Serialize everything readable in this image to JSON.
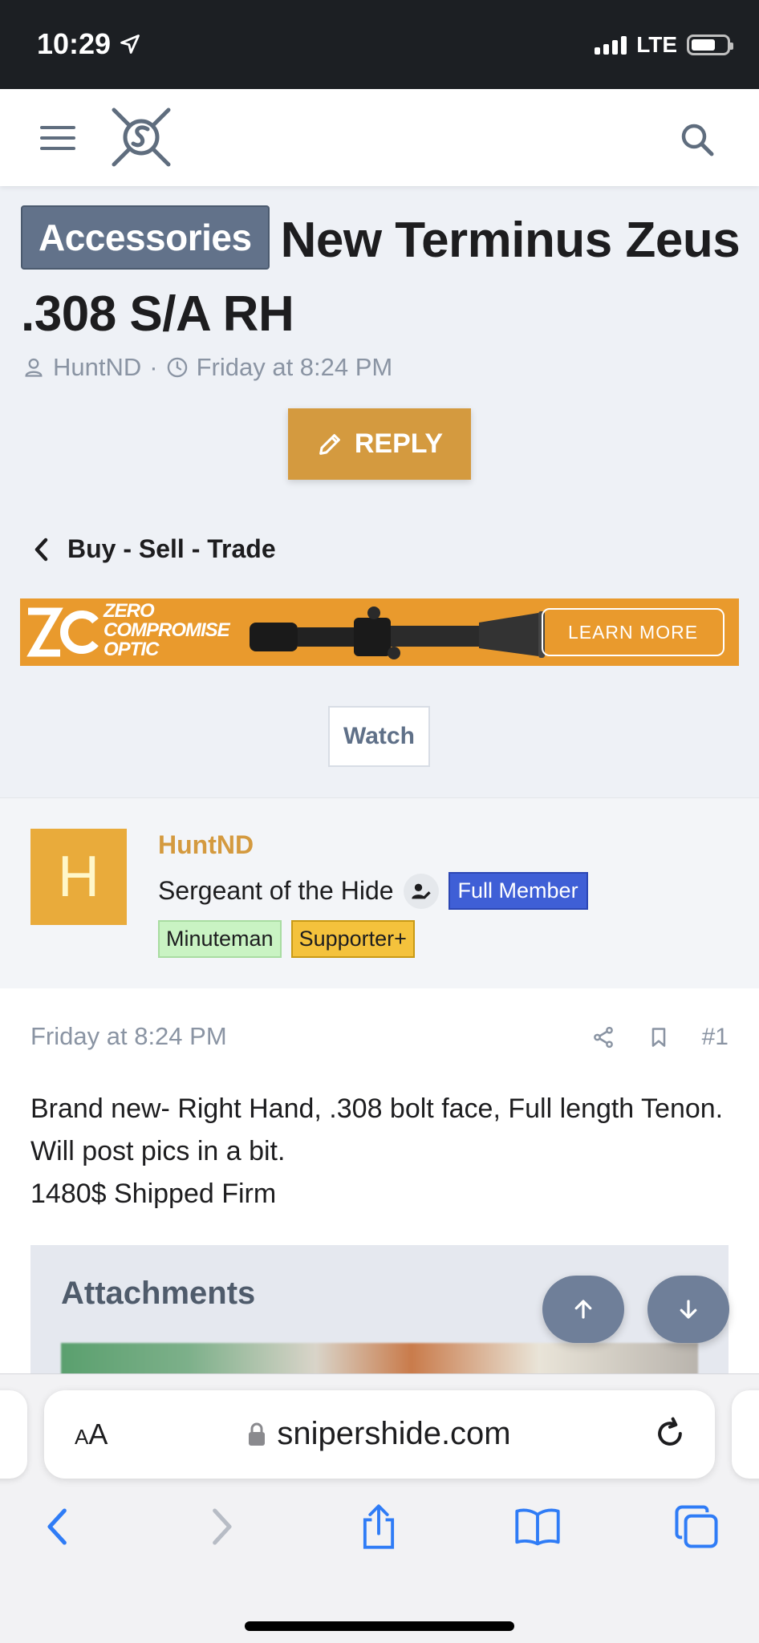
{
  "status_bar": {
    "time": "10:29",
    "network": "LTE"
  },
  "header": {
    "menu_icon": "hamburger-menu-icon",
    "logo_icon": "snipershide-logo-icon",
    "search_icon": "search-icon"
  },
  "thread": {
    "prefix": "Accessories",
    "title": "New Terminus Zeus .308 S/A RH",
    "author": "HuntND",
    "separator": "·",
    "date": "Friday at 8:24 PM"
  },
  "reply_button": {
    "label": "REPLY"
  },
  "breadcrumb": {
    "label": "Buy - Sell - Trade"
  },
  "banner": {
    "brand_line1": "ZERO",
    "brand_line2": "COMPROMISE",
    "brand_line3": "OPTIC",
    "cta": "LEARN MORE",
    "logo_text": "ZC"
  },
  "watch_button": {
    "label": "Watch"
  },
  "post": {
    "avatar_letter": "H",
    "username": "HuntND",
    "user_title": "Sergeant of the Hide",
    "badges": [
      "Full Member",
      "Minuteman",
      "Supporter+"
    ],
    "date": "Friday at 8:24 PM",
    "post_number": "#1",
    "body_lines": [
      "Brand new- Right Hand, .308 bolt face, Full length Tenon. Will post pics in a bit.",
      "1480$ Shipped Firm"
    ],
    "attachments_title": "Attachments"
  },
  "safari": {
    "text_size_label_big": "A",
    "text_size_label_small": "A",
    "url": "snipershide.com"
  },
  "colors": {
    "accent": "#d49a3f",
    "prefix_bg": "#62728a",
    "badge_full": "#3f5fd6",
    "badge_minuteman": "#c9f3c3",
    "badge_supporter": "#f4c23c",
    "status_bar": "#1c1f23"
  }
}
